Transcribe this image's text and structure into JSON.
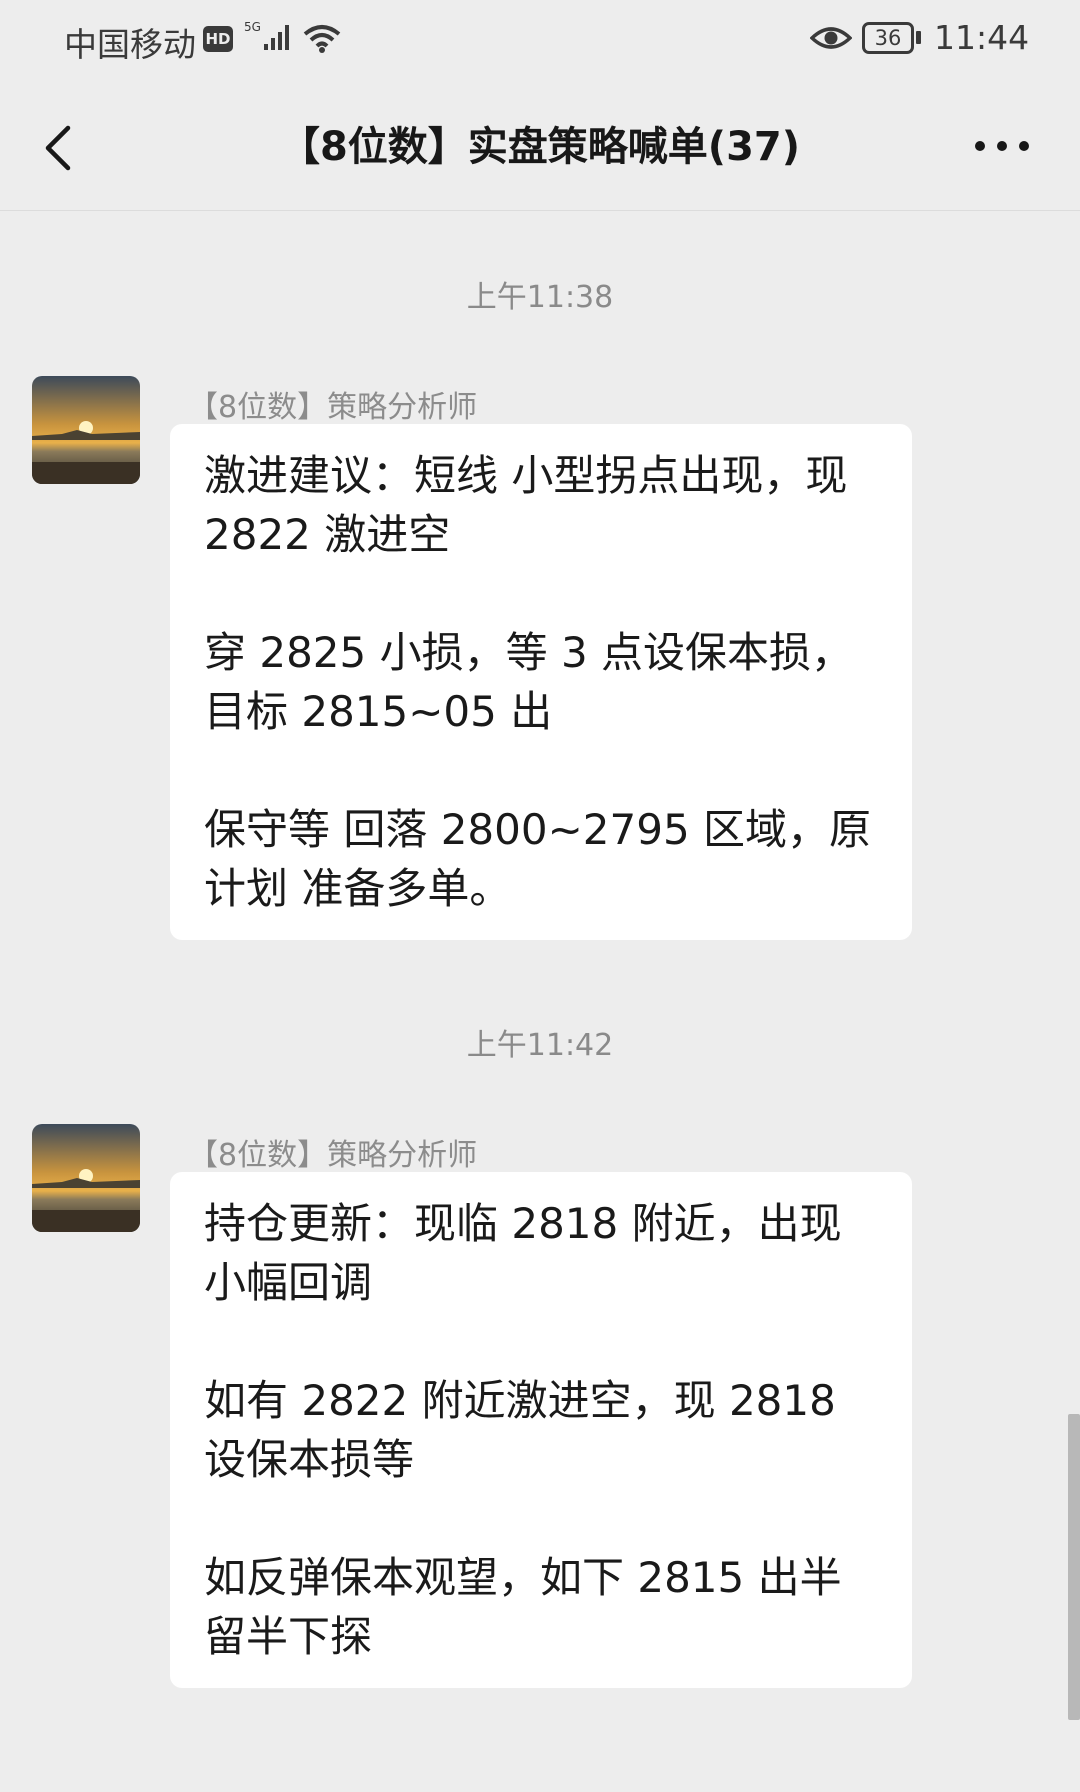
{
  "status_bar": {
    "carrier": "中国移动",
    "hd_badge": "HD",
    "network": "5G",
    "battery": "36",
    "time": "11:44"
  },
  "nav": {
    "title": "【8位数】实盘策略喊单(37)",
    "back_icon": "chevron-left-icon",
    "more_icon": "more-dots-icon"
  },
  "messages": [
    {
      "timestamp": "上午11:38",
      "sender": "【8位数】策略分析师",
      "paragraphs": [
        "激进建议：短线 小型拐点出现，现 2822 激进空",
        "穿 2825 小损，等 3 点设保本损，目标 2815~05 出",
        "保守等 回落 2800~2795 区域，原计划 准备多单。"
      ]
    },
    {
      "timestamp": "上午11:42",
      "sender": "【8位数】策略分析师",
      "paragraphs": [
        "持仓更新：现临 2818 附近，出现小幅回调",
        "如有 2822 附近激进空，现 2818 设保本损等",
        "如反弹保本观望，如下 2815 出半留半下探"
      ]
    }
  ],
  "colors": {
    "background": "#ededed",
    "bubble": "#ffffff",
    "timestamp_text": "#8a8a8a"
  }
}
